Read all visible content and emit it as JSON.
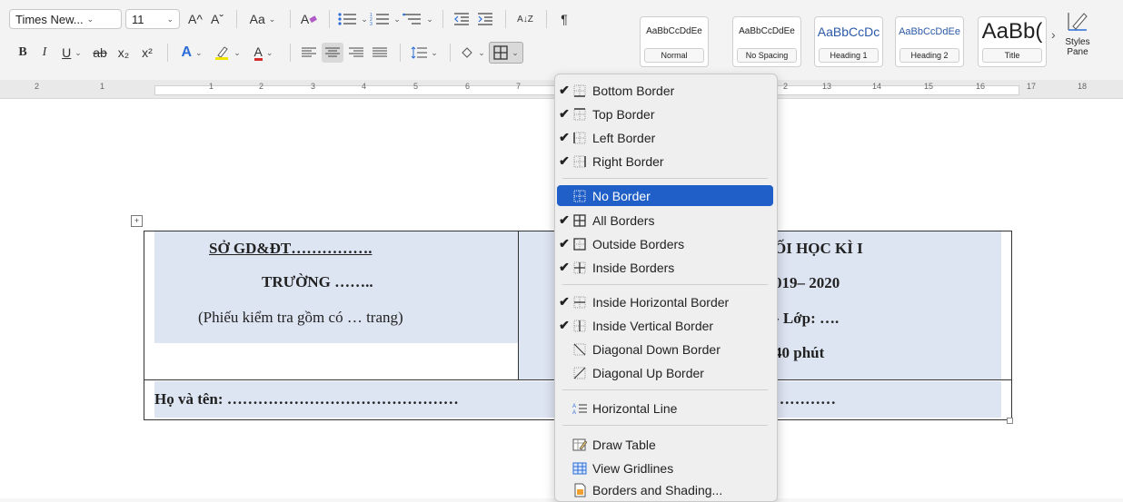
{
  "toolbar": {
    "font_name": "Times New...",
    "font_size": "11",
    "grow_font": "A^",
    "shrink_font": "Aˇ",
    "change_case": "Aa",
    "clear_format": "A",
    "bold": "B",
    "italic": "I",
    "underline": "U",
    "strike": "ab",
    "subscript": "x₂",
    "superscript": "x²",
    "text_effects": "A",
    "font_color": "A",
    "sort": "A↓Z",
    "pilcrow": "¶"
  },
  "styles": [
    {
      "preview": "AaBbCcDdEe",
      "name": "Normal"
    },
    {
      "preview": "AaBbCcDdEe",
      "name": "No Spacing"
    },
    {
      "preview": "AaBbCcDc",
      "name": "Heading 1"
    },
    {
      "preview": "AaBbCcDdEe",
      "name": "Heading 2"
    },
    {
      "preview": "AaBb(",
      "name": "Title"
    }
  ],
  "styles_more": "›",
  "styles_pane": {
    "line1": "Styles",
    "line2": "Pane"
  },
  "ruler_numbers": [
    "2",
    "1",
    "1",
    "2",
    "3",
    "4",
    "5",
    "6",
    "7",
    "2",
    "13",
    "14",
    "15",
    "16",
    "17",
    "18"
  ],
  "document": {
    "left_line1": "SỞ GD&ĐT…………….",
    "left_line2": "TRƯỜNG ……..",
    "left_line3": "(Phiếu kiểm tra gồm có … trang)",
    "right_line1": "ỐI HỌC KÌ I",
    "right_line2": "019– 2020",
    "right_line3": "- Lớp: ….",
    "right_line4": "40 phút",
    "name_label": "Họ và tên: ………………………………………",
    "name_tail": "…………"
  },
  "border_menu": {
    "items": [
      {
        "label": "Bottom Border",
        "checked": "✔"
      },
      {
        "label": "Top Border",
        "checked": "✔"
      },
      {
        "label": "Left Border",
        "checked": "✔"
      },
      {
        "label": "Right Border",
        "checked": "✔"
      },
      {
        "label": "No Border",
        "checked": ""
      },
      {
        "label": "All Borders",
        "checked": "✔"
      },
      {
        "label": "Outside Borders",
        "checked": "✔"
      },
      {
        "label": "Inside Borders",
        "checked": "✔"
      },
      {
        "label": "Inside Horizontal Border",
        "checked": "✔"
      },
      {
        "label": "Inside Vertical Border",
        "checked": "✔"
      },
      {
        "label": "Diagonal Down Border",
        "checked": ""
      },
      {
        "label": "Diagonal Up Border",
        "checked": ""
      },
      {
        "label": "Horizontal Line",
        "checked": ""
      },
      {
        "label": "Draw Table",
        "checked": ""
      },
      {
        "label": "View Gridlines",
        "checked": ""
      },
      {
        "label": "Borders and Shading...",
        "checked": ""
      }
    ]
  },
  "colors": {
    "highlight": "#1f5fc7",
    "table_shade": "#dde4f2",
    "font_color_bar": "#d62b2b",
    "highlight_bar": "#f2e600",
    "effects_blue": "#2b6cd6"
  }
}
